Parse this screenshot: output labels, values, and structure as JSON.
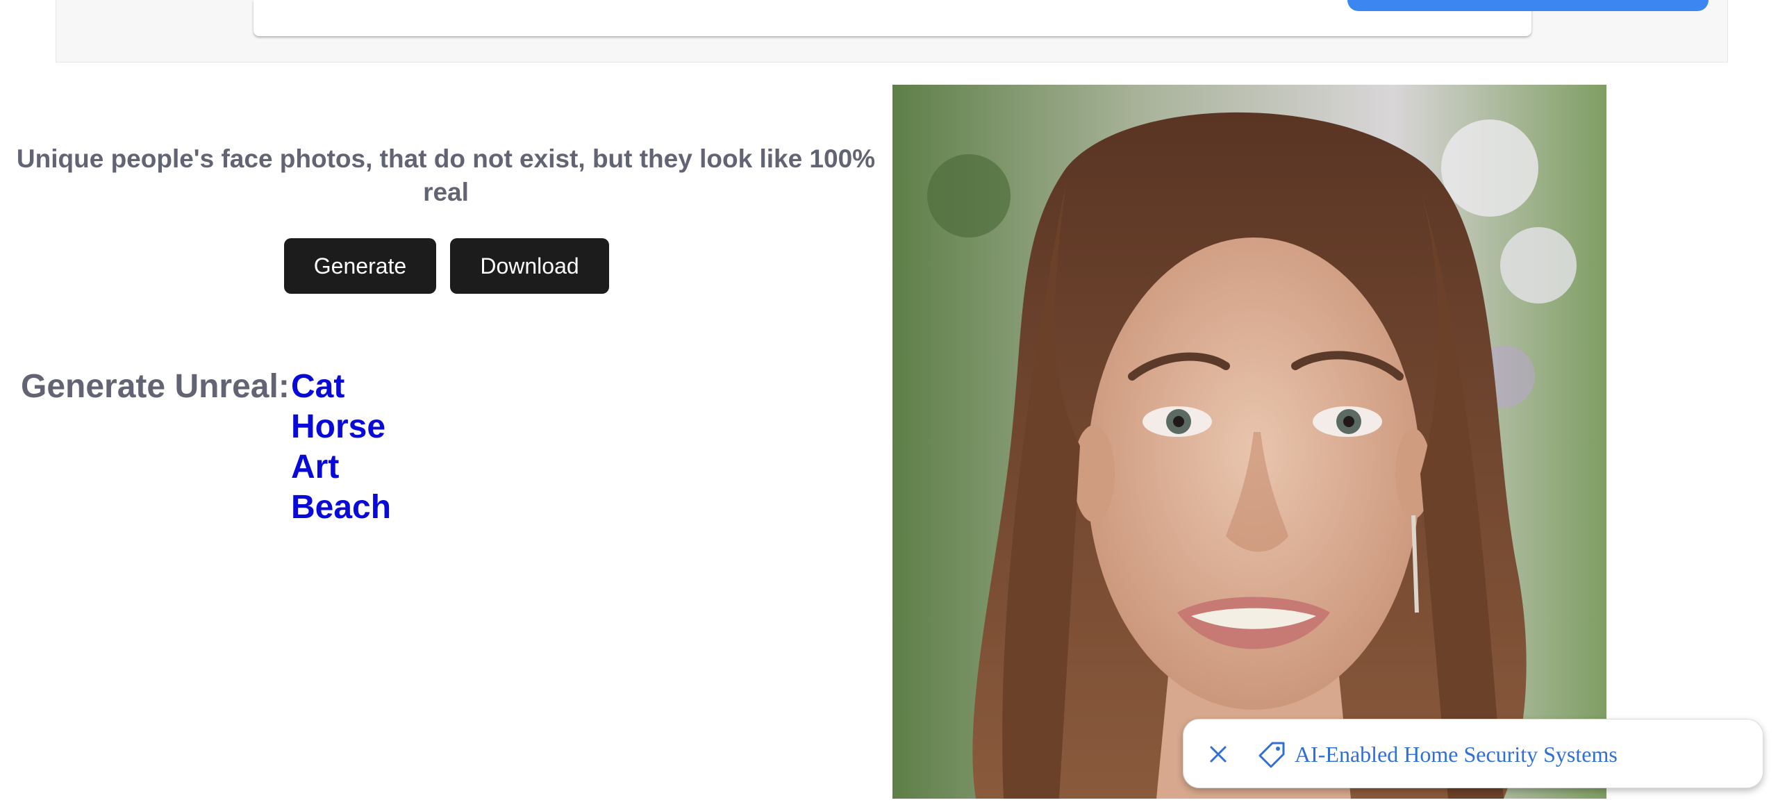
{
  "header": {},
  "hero": {
    "tagline": "Unique people's face photos, that do not exist, but they look like 100% real",
    "generate_label": "Generate",
    "download_label": "Download"
  },
  "generate_unreal": {
    "label": "Generate Unreal:",
    "links": [
      "Cat",
      "Horse",
      "Art",
      "Beach"
    ]
  },
  "photo": {
    "alt": "generated face photo"
  },
  "toast": {
    "text": "AI-Enabled Home Security Systems",
    "close_icon": "close-icon",
    "tag_icon": "tag-icon"
  },
  "colors": {
    "tagline": "#626473",
    "link": "#0a0ad8",
    "button_bg": "#1c1c1c",
    "ad_accent": "#3b86f0",
    "toast_text": "#2f6fd6"
  }
}
